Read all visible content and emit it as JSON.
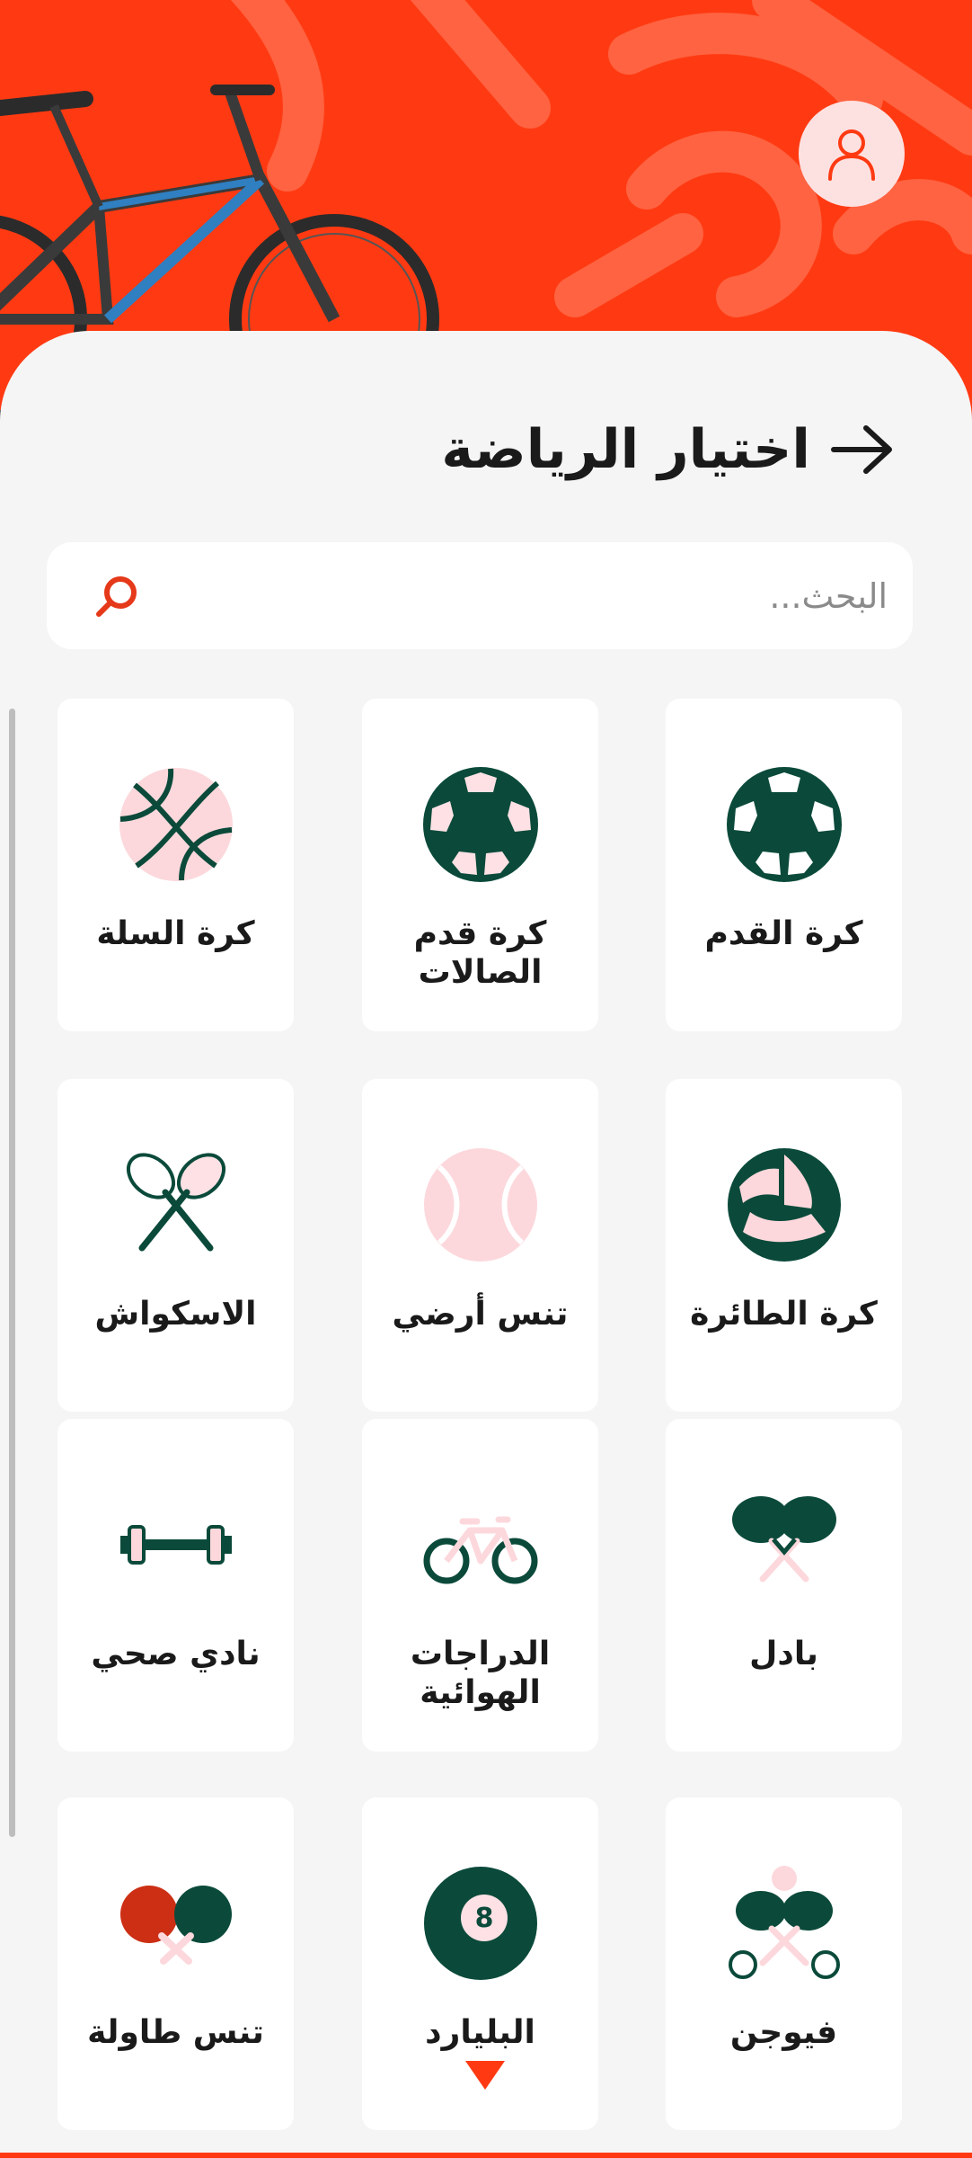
{
  "header": {
    "title": "اختيار الرياضة"
  },
  "search": {
    "placeholder": "البحث..."
  },
  "sports": [
    {
      "label": "كرة القدم",
      "icon": "soccer-ball-icon"
    },
    {
      "label": "كرة قدم الصالات",
      "icon": "futsal-ball-icon"
    },
    {
      "label": "كرة السلة",
      "icon": "basketball-icon"
    },
    {
      "label": "كرة الطائرة",
      "icon": "volleyball-icon"
    },
    {
      "label": "تنس أرضي",
      "icon": "tennis-ball-icon"
    },
    {
      "label": "الاسكواش",
      "icon": "squash-rackets-icon"
    },
    {
      "label": "بادل",
      "icon": "padel-rackets-icon"
    },
    {
      "label": "الدراجات الهوائية",
      "icon": "bicycle-icon"
    },
    {
      "label": "نادي صحي",
      "icon": "dumbbell-icon"
    },
    {
      "label": "فيوجن",
      "icon": "fusion-icon"
    },
    {
      "label": "البليارد",
      "icon": "billiard-ball-icon"
    },
    {
      "label": "تنس طاولة",
      "icon": "table-tennis-icon"
    }
  ],
  "colors": {
    "brand": "#ff3a12",
    "icon_dark": "#0b4a3a",
    "icon_pink": "#fcd8dc",
    "background": "#f5f5f5"
  }
}
